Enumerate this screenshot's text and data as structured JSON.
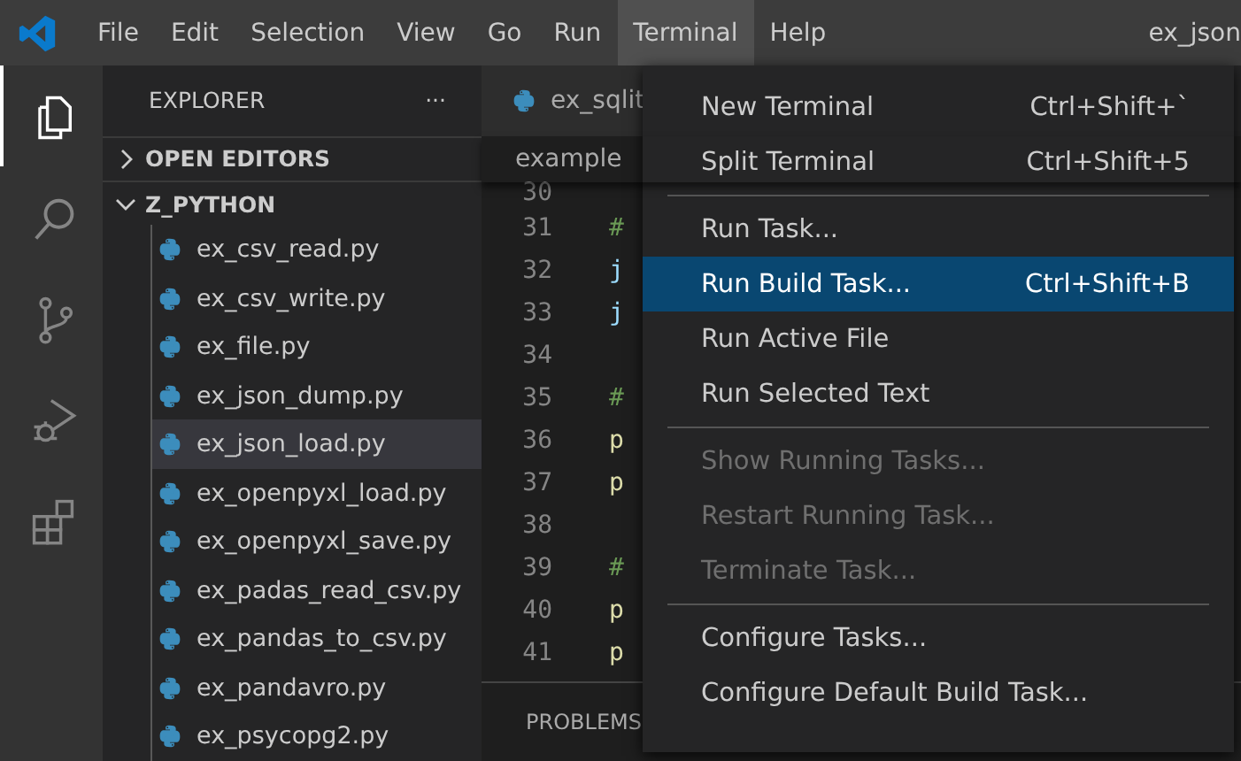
{
  "menubar": [
    {
      "label": "File",
      "selected": false
    },
    {
      "label": "Edit",
      "selected": false
    },
    {
      "label": "Selection",
      "selected": false
    },
    {
      "label": "View",
      "selected": false
    },
    {
      "label": "Go",
      "selected": false
    },
    {
      "label": "Run",
      "selected": false
    },
    {
      "label": "Terminal",
      "selected": true
    },
    {
      "label": "Help",
      "selected": false
    }
  ],
  "window": {
    "title": "ex_json"
  },
  "activity_bar": [
    {
      "kind": "files",
      "selected": true
    },
    {
      "kind": "search",
      "selected": false
    },
    {
      "kind": "source-control",
      "selected": false
    },
    {
      "kind": "run-debug",
      "selected": false
    },
    {
      "kind": "extensions",
      "selected": false
    }
  ],
  "sidebar": {
    "title": "EXPLORER",
    "more": "···",
    "sections": [
      {
        "label": "OPEN EDITORS",
        "expanded": false
      },
      {
        "label": "Z_PYTHON",
        "expanded": true
      }
    ],
    "files": [
      {
        "name": "ex_csv_read.py",
        "selected": false
      },
      {
        "name": "ex_csv_write.py",
        "selected": false
      },
      {
        "name": "ex_file.py",
        "selected": false
      },
      {
        "name": "ex_json_dump.py",
        "selected": false
      },
      {
        "name": "ex_json_load.py",
        "selected": true
      },
      {
        "name": "ex_openpyxl_load.py",
        "selected": false
      },
      {
        "name": "ex_openpyxl_save.py",
        "selected": false
      },
      {
        "name": "ex_padas_read_csv.py",
        "selected": false
      },
      {
        "name": "ex_pandas_to_csv.py",
        "selected": false
      },
      {
        "name": "ex_pandavro.py",
        "selected": false
      },
      {
        "name": "ex_psycopg2.py",
        "selected": false
      }
    ]
  },
  "editor": {
    "tab": "ex_sqlit",
    "breadcrumb": "example",
    "lines": [
      {
        "number": "30"
      },
      {
        "number": "31",
        "code": "#",
        "kind": "comment"
      },
      {
        "number": "32",
        "code": "j",
        "kind": "plain"
      },
      {
        "number": "33",
        "code": "j",
        "kind": "plain"
      },
      {
        "number": "34"
      },
      {
        "number": "35",
        "code": "#",
        "kind": "comment"
      },
      {
        "number": "36",
        "code": "p",
        "kind": "call"
      },
      {
        "number": "37",
        "code": "p",
        "kind": "call"
      },
      {
        "number": "38"
      },
      {
        "number": "39",
        "code": "#",
        "kind": "comment"
      },
      {
        "number": "40",
        "code": "p",
        "kind": "call"
      },
      {
        "number": "41",
        "code": "p",
        "kind": "call"
      }
    ]
  },
  "panel": {
    "tab": "PROBLEMS"
  },
  "terminal_menu": [
    [
      {
        "label": "New Terminal",
        "shortcut": "Ctrl+Shift+`",
        "disabled": false,
        "selected": false
      },
      {
        "label": "Split Terminal",
        "shortcut": "Ctrl+Shift+5",
        "disabled": false,
        "selected": false
      }
    ],
    [
      {
        "label": "Run Task...",
        "disabled": false,
        "selected": false
      },
      {
        "label": "Run Build Task...",
        "shortcut": "Ctrl+Shift+B",
        "disabled": false,
        "selected": true
      },
      {
        "label": "Run Active File",
        "disabled": false,
        "selected": false
      },
      {
        "label": "Run Selected Text",
        "disabled": false,
        "selected": false
      }
    ],
    [
      {
        "label": "Show Running Tasks...",
        "disabled": true,
        "selected": false
      },
      {
        "label": "Restart Running Task...",
        "disabled": true,
        "selected": false
      },
      {
        "label": "Terminate Task...",
        "disabled": true,
        "selected": false
      }
    ],
    [
      {
        "label": "Configure Tasks...",
        "disabled": false,
        "selected": false
      },
      {
        "label": "Configure Default Build Task...",
        "disabled": false,
        "selected": false
      }
    ]
  ]
}
